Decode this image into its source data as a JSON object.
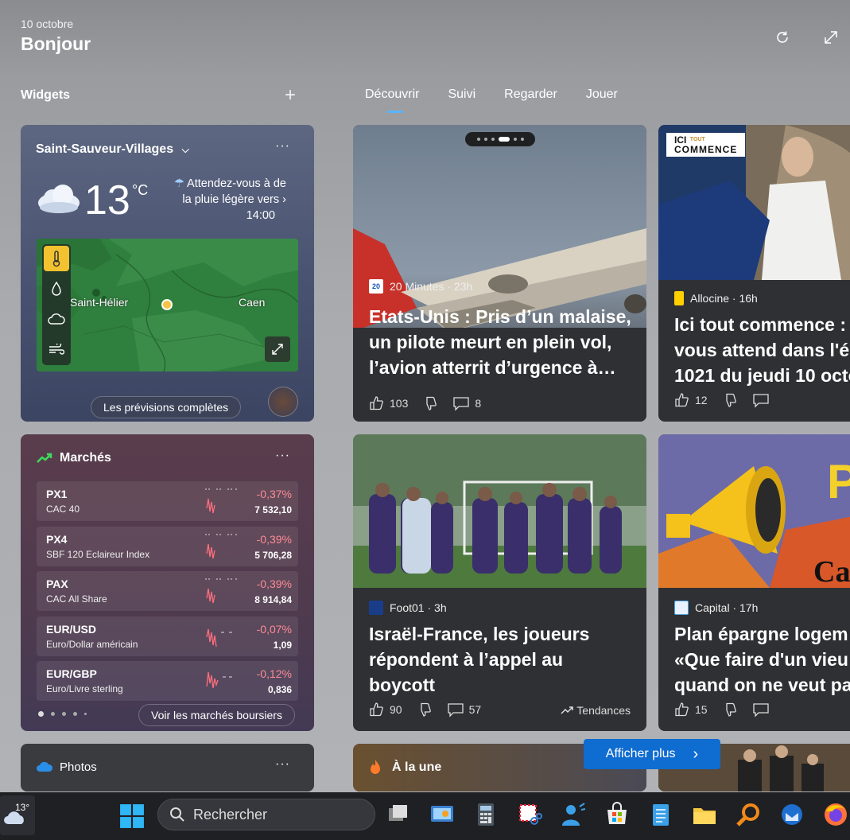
{
  "header": {
    "date": "10 octobre",
    "greeting": "Bonjour",
    "refresh_icon": "refresh-icon",
    "expand_icon": "expand-icon"
  },
  "widgets_panel": {
    "title": "Widgets",
    "add_label": "+"
  },
  "tabs": [
    "Découvrir",
    "Suivi",
    "Regarder",
    "Jouer"
  ],
  "weather": {
    "location": "Saint-Sauveur-Villages",
    "more": "···",
    "temperature": "13",
    "unit": "°C",
    "forecast_line1": "Attendez-vous à de",
    "forecast_line2": "la pluie légère vers",
    "forecast_line3": "14:00",
    "map_city_1": "Saint-Hélier",
    "map_city_2": "Caen",
    "full_forecast": "Les prévisions complètes"
  },
  "markets": {
    "title": "Marchés",
    "more": "···",
    "rows": [
      {
        "symbol": "PX1",
        "name": "CAC 40",
        "change": "-0,37%",
        "value": "7 532,10"
      },
      {
        "symbol": "PX4",
        "name": "SBF 120 Eclaireur Index",
        "change": "-0,39%",
        "value": "5 706,28"
      },
      {
        "symbol": "PAX",
        "name": "CAC All Share",
        "change": "-0,39%",
        "value": "8 914,84"
      },
      {
        "symbol": "EUR/USD",
        "name": "Euro/Dollar américain",
        "change": "-0,07%",
        "value": "1,09"
      },
      {
        "symbol": "EUR/GBP",
        "name": "Euro/Livre sterling",
        "change": "-0,12%",
        "value": "0,836"
      }
    ],
    "see_markets": "Voir les marchés boursiers"
  },
  "photos": {
    "title": "Photos",
    "more": "···"
  },
  "news": [
    {
      "source": "20 Minutes · 23h",
      "headline_1": "Etats-Unis : Pris d’un malaise,",
      "headline_2": "un pilote meurt en plein vol,",
      "headline_3": "l’avion atterrit d’urgence à…",
      "likes": "103",
      "comments": "8"
    },
    {
      "source": "Allocine · 16h",
      "headline_1": "Ici tout commence :",
      "headline_2": "vous attend dans l'é",
      "headline_3": "1021 du jeudi 10 octo",
      "likes": "12",
      "badge_line1": "ICI",
      "badge_line2": "TOUT",
      "badge_line3": "COMMENCE"
    },
    {
      "source": "Foot01 · 3h",
      "headline_1": "Israël-France, les joueurs",
      "headline_2": "répondent à l’appel au",
      "headline_3": "boycott",
      "likes": "90",
      "comments": "57",
      "trending": "Tendances"
    },
    {
      "source": "Capital · 17h",
      "headline_1": "Plan épargne logem",
      "headline_2": "«Que faire d'un vieu",
      "headline_3": "quand on ne veut pa",
      "likes": "15"
    }
  ],
  "a_la_une": "À la une",
  "show_more": "Afficher plus",
  "taskbar": {
    "weather_temp": "13°",
    "search_placeholder": "Rechercher"
  }
}
